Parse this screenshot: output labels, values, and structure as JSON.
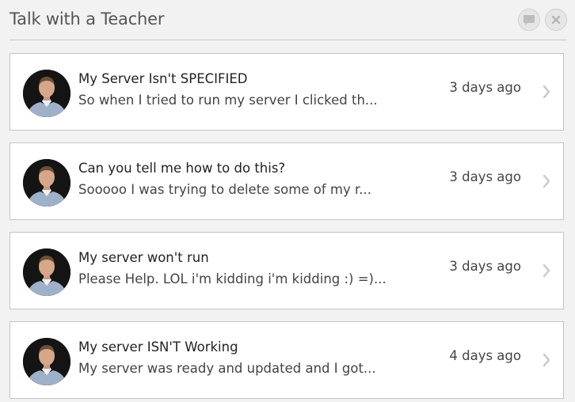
{
  "panel": {
    "title": "Talk with a Teacher"
  },
  "header_buttons": [
    {
      "icon": "chat-bubble-icon"
    },
    {
      "icon": "close-icon"
    }
  ],
  "conversations": [
    {
      "subject": "My Server Isn't SPECIFIED",
      "preview": "So when I tried to run my server I clicked th...",
      "time": "3 days ago"
    },
    {
      "subject": "Can you tell me how to do this?",
      "preview": "Sooooo I was trying to delete some of my r...",
      "time": "3 days ago"
    },
    {
      "subject": "My server won't run",
      "preview": "Please Help. LOL i'm kidding i'm kidding :) =)...",
      "time": "3 days ago"
    },
    {
      "subject": "My server ISN'T Working",
      "preview": "My server was ready and updated and I got...",
      "time": "4 days ago"
    }
  ],
  "colors": {
    "background": "#f2f2f2",
    "card": "#ffffff",
    "border": "#c4c4c4",
    "chevron": "#c8c8c8"
  }
}
